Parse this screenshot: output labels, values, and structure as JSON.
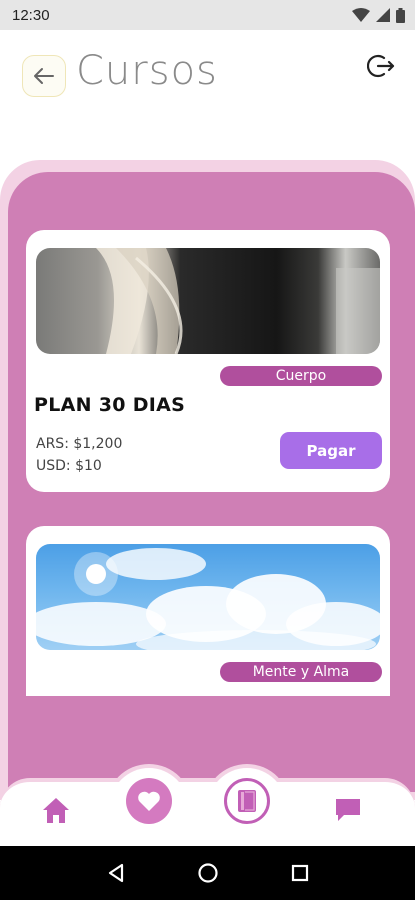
{
  "status_bar": {
    "time": "12:30"
  },
  "header": {
    "title": "Cursos",
    "back_icon": "arrow-left-icon",
    "logout_icon": "logout-icon"
  },
  "courses": [
    {
      "tag": "Cuerpo",
      "title": "PLAN 30 DIAS",
      "price_ars": "ARS: $1,200",
      "price_usd": "USD: $10",
      "pay_label": "Pagar"
    },
    {
      "tag": "Mente y Alma"
    }
  ],
  "bottom_nav": {
    "items": [
      "home-icon",
      "heart-icon",
      "book-icon",
      "chat-icon"
    ]
  },
  "colors": {
    "panel": "#cf7fb5",
    "panel_border": "#f3d2e4",
    "tag": "#b04f9d",
    "pay_button": "#a86ee8",
    "nav_accent": "#c15fb6"
  }
}
